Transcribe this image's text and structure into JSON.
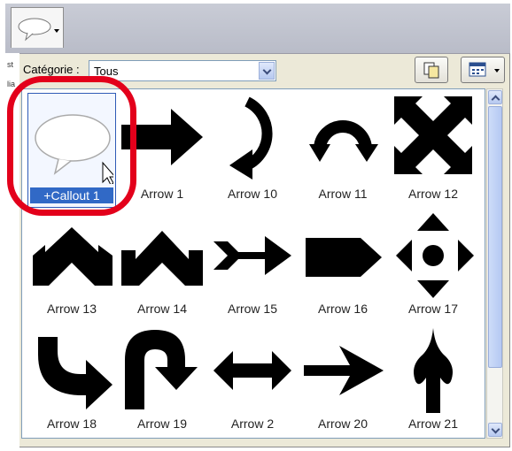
{
  "toolbar": {
    "style_button_icon": "callout-shape-icon"
  },
  "side_fragments": [
    "st",
    "lia"
  ],
  "category": {
    "label": "Catégorie :",
    "selected": "Tous"
  },
  "buttons": {
    "copy_icon": "copy-icon",
    "view_icon": "view-options-icon"
  },
  "shapes": [
    {
      "label": "+Callout 1",
      "icon": "callout-icon",
      "selected": true
    },
    {
      "label": "Arrow 1",
      "icon": "arrow-1-icon"
    },
    {
      "label": "Arrow 10",
      "icon": "arrow-10-icon"
    },
    {
      "label": "Arrow 11",
      "icon": "arrow-11-icon"
    },
    {
      "label": "Arrow 12",
      "icon": "arrow-12-icon"
    },
    {
      "label": "Arrow 13",
      "icon": "arrow-13-icon"
    },
    {
      "label": "Arrow 14",
      "icon": "arrow-14-icon"
    },
    {
      "label": "Arrow 15",
      "icon": "arrow-15-icon"
    },
    {
      "label": "Arrow 16",
      "icon": "arrow-16-icon"
    },
    {
      "label": "Arrow 17",
      "icon": "arrow-17-icon"
    },
    {
      "label": "Arrow 18",
      "icon": "arrow-18-icon"
    },
    {
      "label": "Arrow 19",
      "icon": "arrow-19-icon"
    },
    {
      "label": "Arrow 2",
      "icon": "arrow-2-icon"
    },
    {
      "label": "Arrow 20",
      "icon": "arrow-20-icon"
    },
    {
      "label": "Arrow 21",
      "icon": "arrow-21-icon"
    }
  ],
  "colors": {
    "highlight_ring": "#e3001b",
    "selection": "#3169c6"
  }
}
